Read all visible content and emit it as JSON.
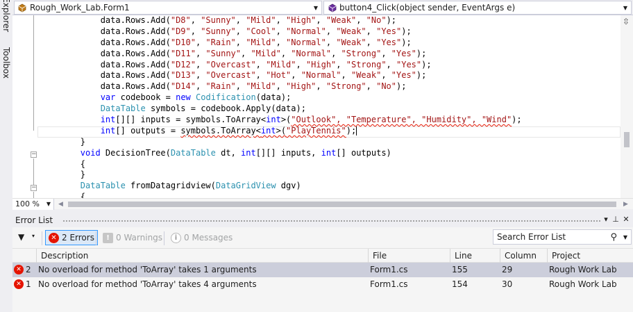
{
  "side_tabs": {
    "explorer": "er Explorer",
    "toolbox": "Toolbox"
  },
  "nav": {
    "left_combo": "Rough_Work_Lab.Form1",
    "right_combo": "button4_Click(object sender, EventArgs e)"
  },
  "code_lines": [
    [
      {
        "c": "tx",
        "t": "            data.Rows.Add("
      },
      {
        "c": "st",
        "t": "\"D8\""
      },
      {
        "c": "tx",
        "t": ", "
      },
      {
        "c": "st",
        "t": "\"Sunny\""
      },
      {
        "c": "tx",
        "t": ", "
      },
      {
        "c": "st",
        "t": "\"Mild\""
      },
      {
        "c": "tx",
        "t": ", "
      },
      {
        "c": "st",
        "t": "\"High\""
      },
      {
        "c": "tx",
        "t": ", "
      },
      {
        "c": "st",
        "t": "\"Weak\""
      },
      {
        "c": "tx",
        "t": ", "
      },
      {
        "c": "st",
        "t": "\"No\""
      },
      {
        "c": "tx",
        "t": ");"
      }
    ],
    [
      {
        "c": "tx",
        "t": "            data.Rows.Add("
      },
      {
        "c": "st",
        "t": "\"D9\""
      },
      {
        "c": "tx",
        "t": ", "
      },
      {
        "c": "st",
        "t": "\"Sunny\""
      },
      {
        "c": "tx",
        "t": ", "
      },
      {
        "c": "st",
        "t": "\"Cool\""
      },
      {
        "c": "tx",
        "t": ", "
      },
      {
        "c": "st",
        "t": "\"Normal\""
      },
      {
        "c": "tx",
        "t": ", "
      },
      {
        "c": "st",
        "t": "\"Weak\""
      },
      {
        "c": "tx",
        "t": ", "
      },
      {
        "c": "st",
        "t": "\"Yes\""
      },
      {
        "c": "tx",
        "t": ");"
      }
    ],
    [
      {
        "c": "tx",
        "t": "            data.Rows.Add("
      },
      {
        "c": "st",
        "t": "\"D10\""
      },
      {
        "c": "tx",
        "t": ", "
      },
      {
        "c": "st",
        "t": "\"Rain\""
      },
      {
        "c": "tx",
        "t": ", "
      },
      {
        "c": "st",
        "t": "\"Mild\""
      },
      {
        "c": "tx",
        "t": ", "
      },
      {
        "c": "st",
        "t": "\"Normal\""
      },
      {
        "c": "tx",
        "t": ", "
      },
      {
        "c": "st",
        "t": "\"Weak\""
      },
      {
        "c": "tx",
        "t": ", "
      },
      {
        "c": "st",
        "t": "\"Yes\""
      },
      {
        "c": "tx",
        "t": ");"
      }
    ],
    [
      {
        "c": "tx",
        "t": "            data.Rows.Add("
      },
      {
        "c": "st",
        "t": "\"D11\""
      },
      {
        "c": "tx",
        "t": ", "
      },
      {
        "c": "st",
        "t": "\"Sunny\""
      },
      {
        "c": "tx",
        "t": ", "
      },
      {
        "c": "st",
        "t": "\"Mild\""
      },
      {
        "c": "tx",
        "t": ", "
      },
      {
        "c": "st",
        "t": "\"Normal\""
      },
      {
        "c": "tx",
        "t": ", "
      },
      {
        "c": "st",
        "t": "\"Strong\""
      },
      {
        "c": "tx",
        "t": ", "
      },
      {
        "c": "st",
        "t": "\"Yes\""
      },
      {
        "c": "tx",
        "t": ");"
      }
    ],
    [
      {
        "c": "tx",
        "t": "            data.Rows.Add("
      },
      {
        "c": "st",
        "t": "\"D12\""
      },
      {
        "c": "tx",
        "t": ", "
      },
      {
        "c": "st",
        "t": "\"Overcast\""
      },
      {
        "c": "tx",
        "t": ", "
      },
      {
        "c": "st",
        "t": "\"Mild\""
      },
      {
        "c": "tx",
        "t": ", "
      },
      {
        "c": "st",
        "t": "\"High\""
      },
      {
        "c": "tx",
        "t": ", "
      },
      {
        "c": "st",
        "t": "\"Strong\""
      },
      {
        "c": "tx",
        "t": ", "
      },
      {
        "c": "st",
        "t": "\"Yes\""
      },
      {
        "c": "tx",
        "t": ");"
      }
    ],
    [
      {
        "c": "tx",
        "t": "            data.Rows.Add("
      },
      {
        "c": "st",
        "t": "\"D13\""
      },
      {
        "c": "tx",
        "t": ", "
      },
      {
        "c": "st",
        "t": "\"Overcast\""
      },
      {
        "c": "tx",
        "t": ", "
      },
      {
        "c": "st",
        "t": "\"Hot\""
      },
      {
        "c": "tx",
        "t": ", "
      },
      {
        "c": "st",
        "t": "\"Normal\""
      },
      {
        "c": "tx",
        "t": ", "
      },
      {
        "c": "st",
        "t": "\"Weak\""
      },
      {
        "c": "tx",
        "t": ", "
      },
      {
        "c": "st",
        "t": "\"Yes\""
      },
      {
        "c": "tx",
        "t": ");"
      }
    ],
    [
      {
        "c": "tx",
        "t": "            data.Rows.Add("
      },
      {
        "c": "st",
        "t": "\"D14\""
      },
      {
        "c": "tx",
        "t": ", "
      },
      {
        "c": "st",
        "t": "\"Rain\""
      },
      {
        "c": "tx",
        "t": ", "
      },
      {
        "c": "st",
        "t": "\"Mild\""
      },
      {
        "c": "tx",
        "t": ", "
      },
      {
        "c": "st",
        "t": "\"High\""
      },
      {
        "c": "tx",
        "t": ", "
      },
      {
        "c": "st",
        "t": "\"Strong\""
      },
      {
        "c": "tx",
        "t": ", "
      },
      {
        "c": "st",
        "t": "\"No\""
      },
      {
        "c": "tx",
        "t": ");"
      }
    ],
    [
      {
        "c": "tx",
        "t": "            "
      },
      {
        "c": "kw",
        "t": "var"
      },
      {
        "c": "tx",
        "t": " codebook = "
      },
      {
        "c": "kw",
        "t": "new"
      },
      {
        "c": "tx",
        "t": " "
      },
      {
        "c": "ty",
        "t": "Codification"
      },
      {
        "c": "tx",
        "t": "(data);"
      }
    ],
    [
      {
        "c": "tx",
        "t": "            "
      },
      {
        "c": "ty",
        "t": "DataTable"
      },
      {
        "c": "tx",
        "t": " symbols = codebook.Apply(data);"
      }
    ],
    [
      {
        "c": "tx",
        "t": "            "
      },
      {
        "c": "kw",
        "t": "int"
      },
      {
        "c": "tx",
        "t": "[][] inputs = symbols.ToArray<"
      },
      {
        "c": "kw",
        "t": "int"
      },
      {
        "c": "tx",
        "t": ">("
      },
      {
        "c": "st sq",
        "t": "\"Outlook\", \"Temperature\", \"Humidity\", \"Wind\""
      },
      {
        "c": "tx",
        "t": ");"
      }
    ],
    [
      {
        "c": "tx",
        "t": "            "
      },
      {
        "c": "kw",
        "t": "int"
      },
      {
        "c": "tx",
        "t": "[] outputs = "
      },
      {
        "c": "tx sq",
        "t": "symbols.ToArray<"
      },
      {
        "c": "kw sq",
        "t": "int"
      },
      {
        "c": "tx sq",
        "t": ">("
      },
      {
        "c": "st sq",
        "t": "\"PlayTennis\""
      },
      {
        "c": "tx",
        "t": ");"
      },
      {
        "c": "caret",
        "t": ""
      }
    ],
    [
      {
        "c": "tx",
        "t": "        }"
      }
    ],
    [
      {
        "c": "tx",
        "t": "        "
      },
      {
        "c": "kw",
        "t": "void"
      },
      {
        "c": "tx",
        "t": " DecisionTree("
      },
      {
        "c": "ty",
        "t": "DataTable"
      },
      {
        "c": "tx",
        "t": " dt, "
      },
      {
        "c": "kw",
        "t": "int"
      },
      {
        "c": "tx",
        "t": "[][] inputs, "
      },
      {
        "c": "kw",
        "t": "int"
      },
      {
        "c": "tx",
        "t": "[] outputs)"
      }
    ],
    [
      {
        "c": "tx",
        "t": "        {"
      }
    ],
    [
      {
        "c": "tx",
        "t": "        }"
      }
    ],
    [
      {
        "c": "tx",
        "t": "        "
      },
      {
        "c": "ty",
        "t": "DataTable"
      },
      {
        "c": "tx",
        "t": " fromDatagridview("
      },
      {
        "c": "ty",
        "t": "DataGridView"
      },
      {
        "c": "tx",
        "t": " dgv)"
      }
    ],
    [
      {
        "c": "tx",
        "t": "        {"
      }
    ]
  ],
  "zoom": {
    "value": "100 %"
  },
  "error_list": {
    "title": "Error List",
    "errors_button": "2 Errors",
    "warnings_button": "0 Warnings",
    "messages_button": "0 Messages",
    "search_placeholder": "Search Error List",
    "columns": {
      "description": "Description",
      "file": "File",
      "line": "Line",
      "column": "Column",
      "project": "Project"
    },
    "rows": [
      {
        "num": "2",
        "description": "No overload for method 'ToArray' takes 1 arguments",
        "file": "Form1.cs",
        "line": "155",
        "column": "29",
        "project": "Rough Work Lab"
      },
      {
        "num": "1",
        "description": "No overload for method 'ToArray' takes 4 arguments",
        "file": "Form1.cs",
        "line": "154",
        "column": "30",
        "project": "Rough Work Lab"
      }
    ]
  },
  "colors": {
    "keyword": "#0000ff",
    "type": "#2b91af",
    "string": "#a31515",
    "error": "#e51400",
    "selection": "#cccedb"
  }
}
